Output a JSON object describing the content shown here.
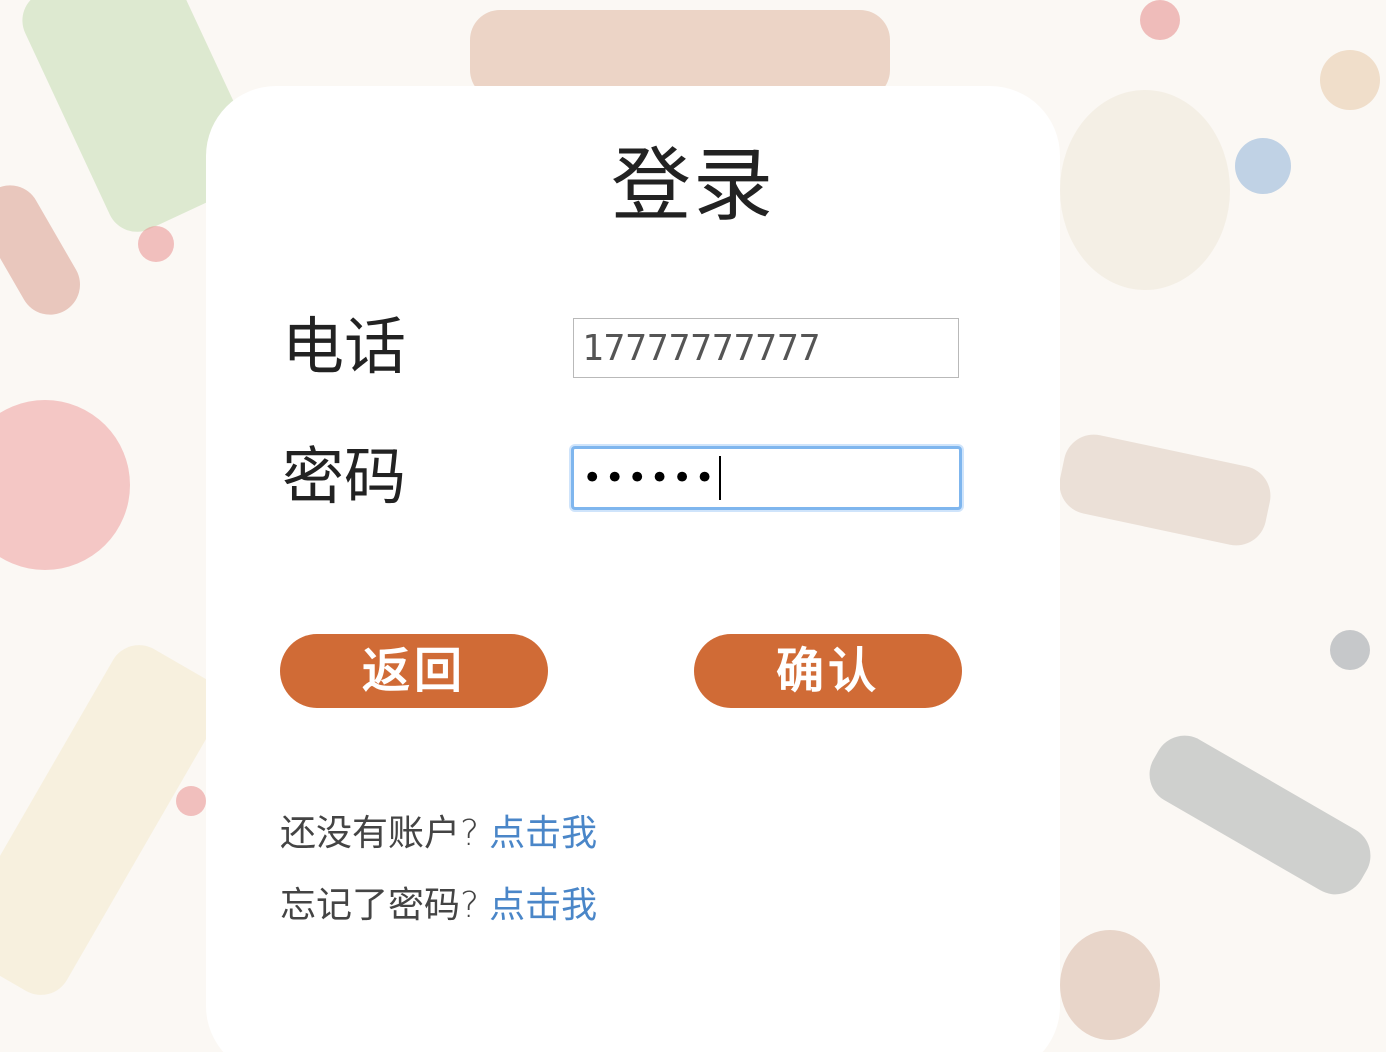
{
  "page": {
    "title": "登录"
  },
  "form": {
    "phone_label": "电话",
    "phone_value": "17777777777",
    "password_label": "密码",
    "password_mask": "••••••"
  },
  "buttons": {
    "back_label": "返回",
    "confirm_label": "确认"
  },
  "links": {
    "register_prompt": "还没有账户?",
    "register_link": "点击我",
    "forgot_prompt": "忘记了密码?",
    "forgot_link": "点击我"
  },
  "colors": {
    "button_bg": "#d06b36",
    "link": "#4a86c8",
    "focus_ring": "#7fb6ee"
  }
}
